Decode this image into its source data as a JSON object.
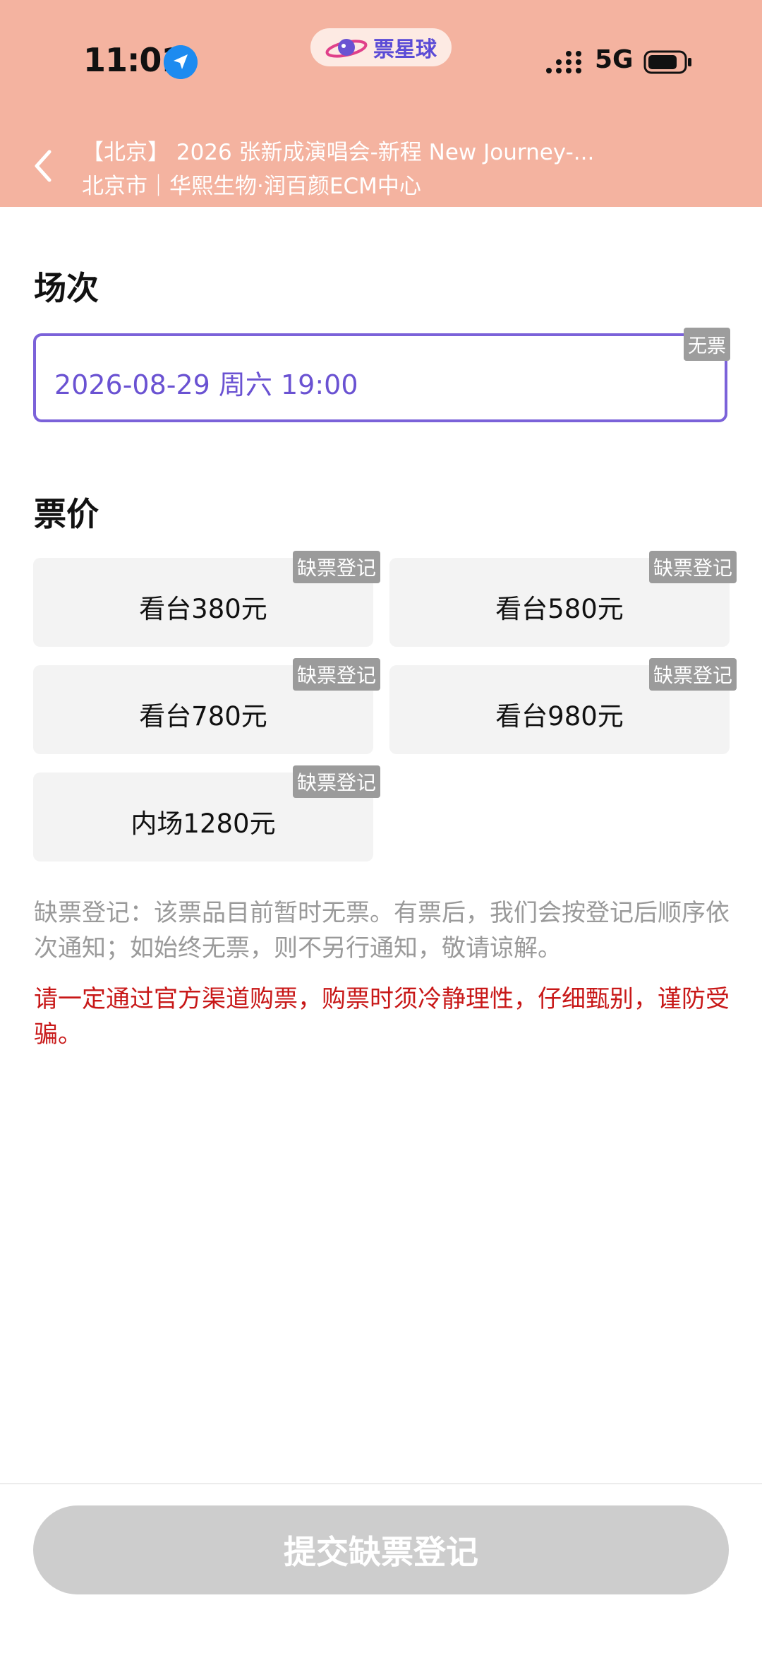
{
  "status_bar": {
    "time": "11:01",
    "network": "5G"
  },
  "brand": {
    "name": "票星球"
  },
  "header": {
    "back_icon": "chevron-left-icon",
    "title": "【北京】 2026 张新成演唱会-新程 New Journey-...",
    "venue": "北京市｜华熙生物·润百颜ECM中心"
  },
  "session": {
    "section_title": "场次",
    "selected": "2026-08-29 周六 19:00",
    "tag": "无票"
  },
  "prices": {
    "section_title": "票价",
    "items": [
      {
        "label": "看台380元",
        "tag": "缺票登记"
      },
      {
        "label": "看台580元",
        "tag": "缺票登记"
      },
      {
        "label": "看台780元",
        "tag": "缺票登记"
      },
      {
        "label": "看台980元",
        "tag": "缺票登记"
      },
      {
        "label": "内场1280元",
        "tag": "缺票登记"
      }
    ]
  },
  "notes": {
    "waitlist_info": "缺票登记：该票品目前暂时无票。有票后，我们会按登记后顺序依次通知；如始终无票，则不另行通知，敬请谅解。",
    "warning": "请一定通过官方渠道购票，购票时须冷静理性，仔细甄别，谨防受骗。"
  },
  "footer": {
    "submit_label": "提交缺票登记"
  },
  "colors": {
    "header_bg": "#f4b3a0",
    "accent": "#7b62d9",
    "warning": "#c81818",
    "tag_bg": "#9b9b9b",
    "disabled_button": "#cdcdcd"
  }
}
